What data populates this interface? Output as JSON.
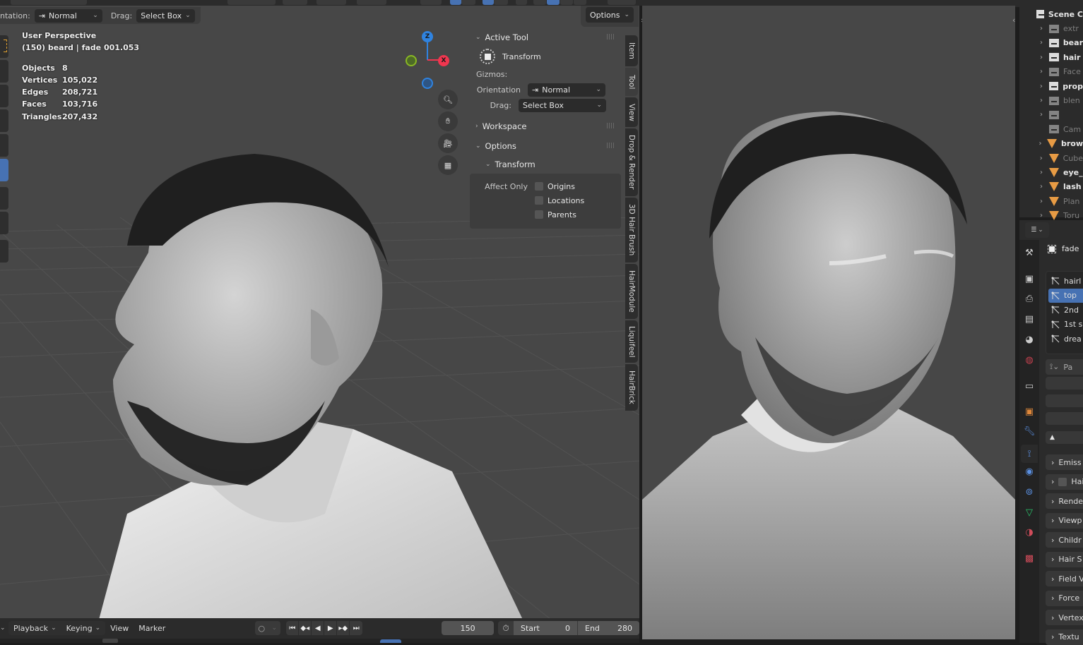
{
  "header": {
    "orientation_label": "ntation:",
    "orientation_value": "Normal",
    "drag_label": "Drag:",
    "drag_value": "Select Box",
    "options_label": "Options"
  },
  "viewport_overlay": {
    "view_name": "User Perspective",
    "object_info": "(150) beard | fade 001.053",
    "stats": [
      {
        "label": "Objects",
        "value": "8"
      },
      {
        "label": "Vertices",
        "value": "105,022"
      },
      {
        "label": "Edges",
        "value": "208,721"
      },
      {
        "label": "Faces",
        "value": "103,716"
      },
      {
        "label": "Triangles",
        "value": "207,432"
      }
    ]
  },
  "gizmo": {
    "z_label": "Z",
    "x_label": "X",
    "colors": {
      "z": "#2f83e0",
      "x": "#f0364f",
      "y": "#89b823"
    }
  },
  "nav_buttons": [
    "zoom-icon",
    "hand-pan-icon",
    "camera-view-icon",
    "orthographic-grid-icon"
  ],
  "npanel": {
    "active_tool": {
      "title": "Active Tool",
      "tool_name": "Transform",
      "gizmos_label": "Gizmos:",
      "orientation_label": "Orientation",
      "orientation_value": "Normal",
      "drag_label": "Drag:",
      "drag_value": "Select Box"
    },
    "workspace_title": "Workspace",
    "options_title": "Options",
    "transform_title": "Transform",
    "affect_only_label": "Affect Only",
    "affect_only": [
      {
        "label": "Origins",
        "checked": false
      },
      {
        "label": "Locations",
        "checked": false
      },
      {
        "label": "Parents",
        "checked": false
      }
    ]
  },
  "side_tabs": [
    "Item",
    "Tool",
    "View",
    "Drop & Render",
    "3D Hair Brush",
    "HairModule",
    "Liquifeel",
    "HairBrick"
  ],
  "active_side_tab": "Tool",
  "timeline": {
    "menus": [
      "Playback",
      "Keying",
      "View",
      "Marker"
    ],
    "current_frame": "150",
    "start_label": "Start",
    "start_value": "0",
    "end_label": "End",
    "end_value": "280"
  },
  "outliner": {
    "items": [
      {
        "label": "Scene C",
        "type": "collection",
        "dim": false,
        "expand": false,
        "root": true
      },
      {
        "label": "extr",
        "type": "collection",
        "dim": true,
        "expand": true
      },
      {
        "label": "bear",
        "type": "collection",
        "dim": false,
        "expand": true
      },
      {
        "label": "hair",
        "type": "collection",
        "dim": false,
        "expand": true
      },
      {
        "label": "Face",
        "type": "collection",
        "dim": true,
        "expand": true
      },
      {
        "label": "prop",
        "type": "collection",
        "dim": false,
        "expand": true
      },
      {
        "label": "blen",
        "type": "collection",
        "dim": true,
        "expand": true
      },
      {
        "label": "",
        "type": "collection",
        "dim": true,
        "expand": true
      },
      {
        "label": "Cam",
        "type": "collection",
        "dim": true,
        "expand": false
      },
      {
        "label": "brow",
        "type": "mesh",
        "dim": false,
        "expand": true
      },
      {
        "label": "Cube",
        "type": "mesh",
        "dim": true,
        "expand": true
      },
      {
        "label": "eye_",
        "type": "mesh",
        "dim": false,
        "expand": true
      },
      {
        "label": "lash",
        "type": "mesh",
        "dim": false,
        "expand": true
      },
      {
        "label": "Plan",
        "type": "mesh",
        "dim": true,
        "expand": true
      },
      {
        "label": "Toru",
        "type": "mesh",
        "dim": true,
        "expand": true
      }
    ]
  },
  "properties": {
    "object_name": "fade",
    "particle_systems": [
      "hairl",
      "top",
      "2nd",
      "1st s",
      "drea"
    ],
    "selected_system": "top",
    "particle_settings_placeholder": "Pa",
    "sections": [
      "Emiss",
      "Hai",
      "Rende",
      "Viewp",
      "Childr",
      "Hair S",
      "Field V",
      "Force",
      "Vertex",
      "Textu"
    ]
  }
}
